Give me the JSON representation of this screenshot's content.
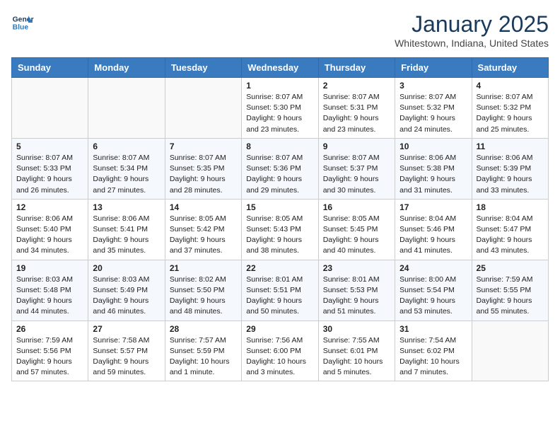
{
  "header": {
    "logo_line1": "General",
    "logo_line2": "Blue",
    "month_year": "January 2025",
    "location": "Whitestown, Indiana, United States"
  },
  "days_of_week": [
    "Sunday",
    "Monday",
    "Tuesday",
    "Wednesday",
    "Thursday",
    "Friday",
    "Saturday"
  ],
  "weeks": [
    [
      {
        "day": "",
        "info": ""
      },
      {
        "day": "",
        "info": ""
      },
      {
        "day": "",
        "info": ""
      },
      {
        "day": "1",
        "info": "Sunrise: 8:07 AM\nSunset: 5:30 PM\nDaylight: 9 hours and 23 minutes."
      },
      {
        "day": "2",
        "info": "Sunrise: 8:07 AM\nSunset: 5:31 PM\nDaylight: 9 hours and 23 minutes."
      },
      {
        "day": "3",
        "info": "Sunrise: 8:07 AM\nSunset: 5:32 PM\nDaylight: 9 hours and 24 minutes."
      },
      {
        "day": "4",
        "info": "Sunrise: 8:07 AM\nSunset: 5:32 PM\nDaylight: 9 hours and 25 minutes."
      }
    ],
    [
      {
        "day": "5",
        "info": "Sunrise: 8:07 AM\nSunset: 5:33 PM\nDaylight: 9 hours and 26 minutes."
      },
      {
        "day": "6",
        "info": "Sunrise: 8:07 AM\nSunset: 5:34 PM\nDaylight: 9 hours and 27 minutes."
      },
      {
        "day": "7",
        "info": "Sunrise: 8:07 AM\nSunset: 5:35 PM\nDaylight: 9 hours and 28 minutes."
      },
      {
        "day": "8",
        "info": "Sunrise: 8:07 AM\nSunset: 5:36 PM\nDaylight: 9 hours and 29 minutes."
      },
      {
        "day": "9",
        "info": "Sunrise: 8:07 AM\nSunset: 5:37 PM\nDaylight: 9 hours and 30 minutes."
      },
      {
        "day": "10",
        "info": "Sunrise: 8:06 AM\nSunset: 5:38 PM\nDaylight: 9 hours and 31 minutes."
      },
      {
        "day": "11",
        "info": "Sunrise: 8:06 AM\nSunset: 5:39 PM\nDaylight: 9 hours and 33 minutes."
      }
    ],
    [
      {
        "day": "12",
        "info": "Sunrise: 8:06 AM\nSunset: 5:40 PM\nDaylight: 9 hours and 34 minutes."
      },
      {
        "day": "13",
        "info": "Sunrise: 8:06 AM\nSunset: 5:41 PM\nDaylight: 9 hours and 35 minutes."
      },
      {
        "day": "14",
        "info": "Sunrise: 8:05 AM\nSunset: 5:42 PM\nDaylight: 9 hours and 37 minutes."
      },
      {
        "day": "15",
        "info": "Sunrise: 8:05 AM\nSunset: 5:43 PM\nDaylight: 9 hours and 38 minutes."
      },
      {
        "day": "16",
        "info": "Sunrise: 8:05 AM\nSunset: 5:45 PM\nDaylight: 9 hours and 40 minutes."
      },
      {
        "day": "17",
        "info": "Sunrise: 8:04 AM\nSunset: 5:46 PM\nDaylight: 9 hours and 41 minutes."
      },
      {
        "day": "18",
        "info": "Sunrise: 8:04 AM\nSunset: 5:47 PM\nDaylight: 9 hours and 43 minutes."
      }
    ],
    [
      {
        "day": "19",
        "info": "Sunrise: 8:03 AM\nSunset: 5:48 PM\nDaylight: 9 hours and 44 minutes."
      },
      {
        "day": "20",
        "info": "Sunrise: 8:03 AM\nSunset: 5:49 PM\nDaylight: 9 hours and 46 minutes."
      },
      {
        "day": "21",
        "info": "Sunrise: 8:02 AM\nSunset: 5:50 PM\nDaylight: 9 hours and 48 minutes."
      },
      {
        "day": "22",
        "info": "Sunrise: 8:01 AM\nSunset: 5:51 PM\nDaylight: 9 hours and 50 minutes."
      },
      {
        "day": "23",
        "info": "Sunrise: 8:01 AM\nSunset: 5:53 PM\nDaylight: 9 hours and 51 minutes."
      },
      {
        "day": "24",
        "info": "Sunrise: 8:00 AM\nSunset: 5:54 PM\nDaylight: 9 hours and 53 minutes."
      },
      {
        "day": "25",
        "info": "Sunrise: 7:59 AM\nSunset: 5:55 PM\nDaylight: 9 hours and 55 minutes."
      }
    ],
    [
      {
        "day": "26",
        "info": "Sunrise: 7:59 AM\nSunset: 5:56 PM\nDaylight: 9 hours and 57 minutes."
      },
      {
        "day": "27",
        "info": "Sunrise: 7:58 AM\nSunset: 5:57 PM\nDaylight: 9 hours and 59 minutes."
      },
      {
        "day": "28",
        "info": "Sunrise: 7:57 AM\nSunset: 5:59 PM\nDaylight: 10 hours and 1 minute."
      },
      {
        "day": "29",
        "info": "Sunrise: 7:56 AM\nSunset: 6:00 PM\nDaylight: 10 hours and 3 minutes."
      },
      {
        "day": "30",
        "info": "Sunrise: 7:55 AM\nSunset: 6:01 PM\nDaylight: 10 hours and 5 minutes."
      },
      {
        "day": "31",
        "info": "Sunrise: 7:54 AM\nSunset: 6:02 PM\nDaylight: 10 hours and 7 minutes."
      },
      {
        "day": "",
        "info": ""
      }
    ]
  ]
}
